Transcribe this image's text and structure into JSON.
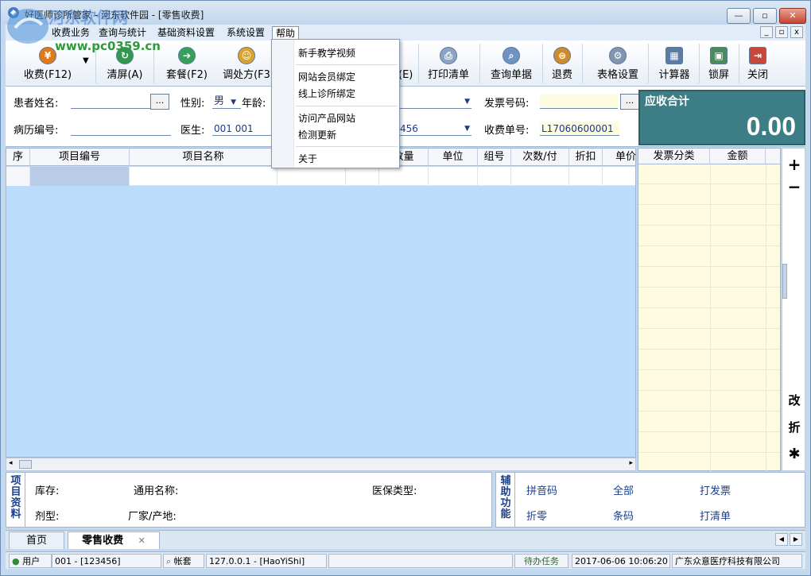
{
  "window": {
    "title": "好医师诊所管家 - 河东软件园 - [零售收费]",
    "minimize": "—",
    "maximize": "▫",
    "close": "✕"
  },
  "watermark": {
    "site_name": "河东软件网",
    "url": "www.pc0359.cn"
  },
  "menubar": {
    "items": [
      "收费业务",
      "查询与统计",
      "基础资料设置",
      "系统设置",
      "帮助"
    ],
    "active": "帮助"
  },
  "mdi_controls": [
    "_",
    "▫",
    "x"
  ],
  "help_menu": {
    "groups": [
      [
        "新手教学视频"
      ],
      [
        "网站会员绑定",
        "线上诊所绑定"
      ],
      [
        "访问产品网站",
        "检测更新"
      ],
      [
        "关于"
      ]
    ]
  },
  "toolbar": {
    "buttons": [
      {
        "label": "收费(F12)",
        "icon": "yuan-icon"
      },
      {
        "label": "清屏(A)",
        "icon": "refresh-icon"
      },
      {
        "label": "套餐(F2)",
        "icon": "package-icon"
      },
      {
        "label": "调处方(F3",
        "icon": "prescription-icon"
      },
      {
        "label": "(E)",
        "icon": "hidden-icon"
      },
      {
        "label": "打印清单",
        "icon": "printer-icon"
      },
      {
        "label": "查询单据",
        "icon": "search-doc-icon"
      },
      {
        "label": "退费",
        "icon": "refund-icon"
      },
      {
        "label": "表格设置",
        "icon": "gear-icon"
      },
      {
        "label": "计算器",
        "icon": "calculator-icon"
      },
      {
        "label": "锁屏",
        "icon": "lock-screen-icon"
      },
      {
        "label": "关闭",
        "icon": "exit-icon"
      }
    ],
    "dropdown_arrow": "▼"
  },
  "form": {
    "patient_name_label": "患者姓名:",
    "patient_name_value": "",
    "lookup_button": "...",
    "gender_label": "性别:",
    "gender_value": "男",
    "age_label": "年龄:",
    "hidden_dropdown_value": "",
    "invoice_no_label": "发票号码:",
    "invoice_no_value": "",
    "record_no_label": "病历编号:",
    "record_no_value": "",
    "doctor_label": "医生:",
    "doctor_value": "001 001",
    "dept_partial_value": "456",
    "receipt_no_label": "收费单号:",
    "receipt_no_value": "L17060600001"
  },
  "total": {
    "label": "应收合计",
    "value": "0.00"
  },
  "grid": {
    "columns": [
      "序",
      "项目编号",
      "项目名称",
      "",
      "",
      "数量",
      "单位",
      "组号",
      "次数/付",
      "折扣",
      "单价"
    ]
  },
  "invoice_panel": {
    "columns": [
      "发票分类",
      "金额"
    ]
  },
  "side_tools": [
    "+",
    "−",
    "改",
    "折",
    "✱"
  ],
  "item_info": {
    "title": "项目资料",
    "stock_label": "库存:",
    "generic_name_label": "通用名称:",
    "insurance_label": "医保类型:",
    "form_label": "剂型:",
    "maker_label": "厂家/产地:"
  },
  "assist": {
    "title": "辅助功能",
    "links": [
      "拼音码",
      "全部",
      "打发票",
      "折零",
      "条码",
      "打清单"
    ]
  },
  "tabs": {
    "items": [
      "首页",
      "零售收费"
    ],
    "active": "零售收费",
    "close": "✕"
  },
  "statusbar": {
    "user_label": "用户",
    "user_value": "001 - [123456]",
    "account_label": "帐套",
    "server": "127.0.0.1 - [HaoYiShi]",
    "tasks": "待办任务",
    "datetime": "2017-06-06 10:06:20",
    "company": "广东众意医疗科技有限公司"
  },
  "colors": {
    "total_bg": "#3d7e86",
    "grid_bg": "#bcdcfb",
    "invoice_bg": "#fdfbe0"
  }
}
